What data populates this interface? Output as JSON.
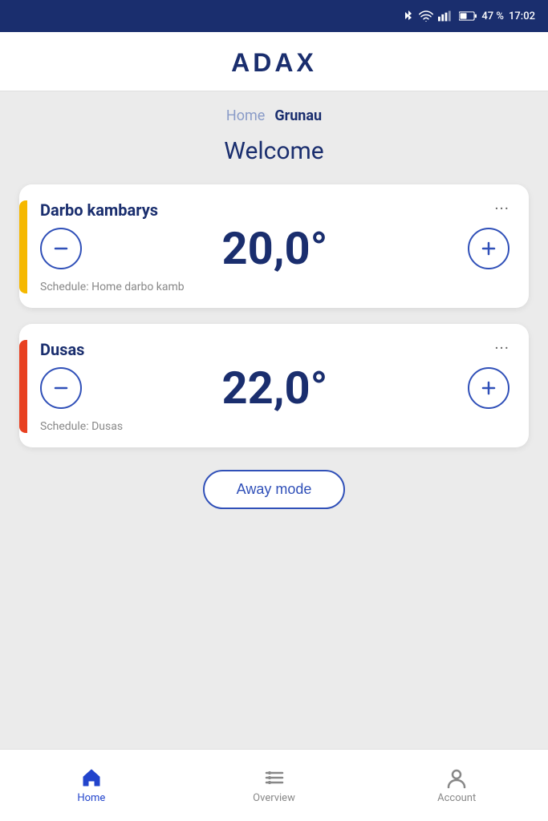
{
  "statusBar": {
    "battery": "47 %",
    "time": "17:02"
  },
  "header": {
    "logo": "ADAX"
  },
  "breadcrumb": {
    "home": "Home",
    "current": "Grunau"
  },
  "welcome": {
    "title": "Welcome"
  },
  "cards": [
    {
      "id": "card-1",
      "accentColor": "yellow",
      "roomName": "Darbo kambarys",
      "temperature": "20,0°",
      "schedule": "Schedule: Home darbo kamb"
    },
    {
      "id": "card-2",
      "accentColor": "orange",
      "roomName": "Dusas",
      "temperature": "22,0°",
      "schedule": "Schedule: Dusas"
    }
  ],
  "awayMode": {
    "label": "Away mode"
  },
  "bottomNav": {
    "items": [
      {
        "id": "home",
        "label": "Home",
        "active": true
      },
      {
        "id": "overview",
        "label": "Overview",
        "active": false
      },
      {
        "id": "account",
        "label": "Account",
        "active": false
      }
    ]
  }
}
